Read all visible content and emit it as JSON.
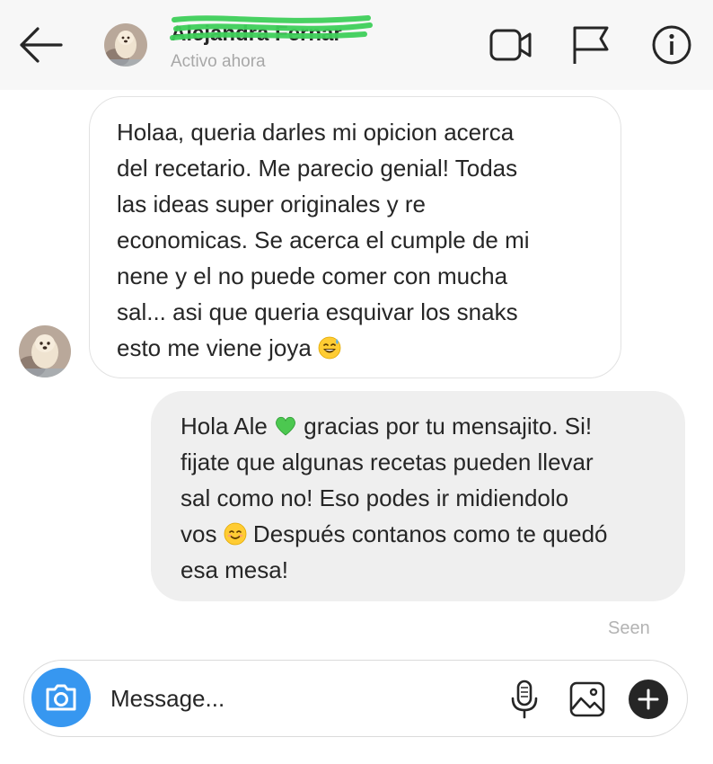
{
  "header": {
    "contact_name": "Alejandra Fernar",
    "status": "Activo ahora",
    "icons": {
      "back": "arrow-left-icon",
      "video": "video-camera-icon",
      "flag": "flag-icon",
      "info": "info-icon"
    }
  },
  "messages": [
    {
      "direction": "incoming",
      "text": "Holaa, queria darles mi opicion acerca\ndel recetario. Me parecio genial! Todas\nlas ideas super originales y re\neconomicas. Se acerca el cumple de mi\nnene y el no puede comer con mucha\nsal... asi que queria esquivar los snaks\nesto me viene joya ",
      "emoji": "grinning-sweat-emoji"
    },
    {
      "direction": "outgoing",
      "text_before": "Hola Ale ",
      "emoji_1": "green-heart-emoji",
      "text_middle": " gracias por tu mensajito. Si!\nfijate que algunas recetas pueden llevar\nsal como no! Eso podes ir midiendolo\nvos ",
      "emoji_2": "smiling-face-emoji",
      "text_after": " Después contanos como te quedó\nesa mesa!"
    }
  ],
  "seen_label": "Seen",
  "composer": {
    "placeholder": "Message...",
    "icons": {
      "camera": "camera-icon",
      "mic": "microphone-icon",
      "gallery": "image-gallery-icon",
      "add": "plus-circle-icon"
    }
  },
  "colors": {
    "header_bg": "#f7f7f7",
    "outgoing_bubble": "#efefef",
    "camera_button": "#3797f0",
    "status_text": "#a8a8a8",
    "scribble": "#3ecf5a"
  }
}
